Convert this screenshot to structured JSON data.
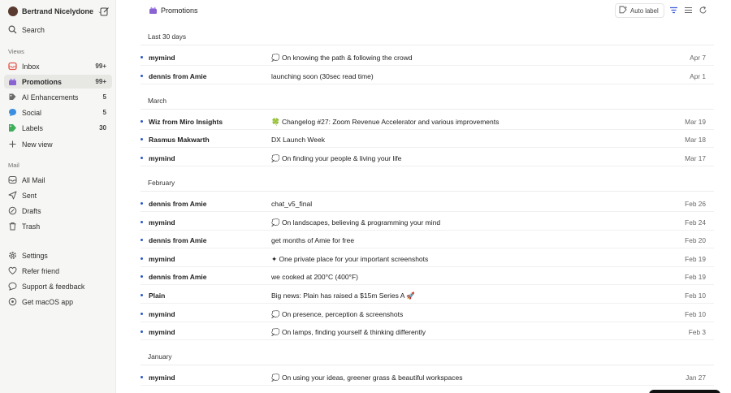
{
  "account": {
    "name": "Bertrand Nicelydone"
  },
  "search": {
    "label": "Search"
  },
  "views": {
    "heading": "Views",
    "items": [
      {
        "label": "Inbox",
        "count": "99+",
        "icon": "inbox-icon",
        "color": "#e2574c"
      },
      {
        "label": "Promotions",
        "count": "99+",
        "icon": "promotions-icon",
        "color": "#8a63d2"
      },
      {
        "label": "AI Enhancements",
        "count": "5",
        "icon": "tag-icon",
        "color": "#6b6b6b"
      },
      {
        "label": "Social",
        "count": "5",
        "icon": "social-icon",
        "color": "#3b8fe0"
      },
      {
        "label": "Labels",
        "count": "30",
        "icon": "labels-icon",
        "color": "#3fae5a"
      }
    ],
    "new_view": "New view"
  },
  "mail": {
    "heading": "Mail",
    "items": [
      {
        "label": "All Mail",
        "icon": "all-mail-icon"
      },
      {
        "label": "Sent",
        "icon": "sent-icon"
      },
      {
        "label": "Drafts",
        "icon": "drafts-icon"
      },
      {
        "label": "Trash",
        "icon": "trash-icon"
      }
    ]
  },
  "footer": {
    "settings": "Settings",
    "refer": "Refer friend",
    "support": "Support & feedback",
    "macos": "Get macOS app"
  },
  "topbar": {
    "title": "Promotions",
    "auto_label": "Auto label",
    "accent": "#3a5bd9"
  },
  "groups": [
    {
      "heading": "Last 30 days",
      "rows": [
        {
          "sender": "mymind",
          "subject": "💭 On knowing the path & following the crowd",
          "date": "Apr 7"
        },
        {
          "sender": "dennis from Amie",
          "subject": "launching soon (30sec read time)",
          "date": "Apr 1"
        }
      ]
    },
    {
      "heading": "March",
      "rows": [
        {
          "sender": "Wiz from Miro Insights",
          "subject": "🍀 Changelog #27: Zoom Revenue Accelerator and various improvements",
          "date": "Mar 19"
        },
        {
          "sender": "Rasmus Makwarth",
          "subject": "DX Launch Week",
          "date": "Mar 18"
        },
        {
          "sender": "mymind",
          "subject": "💭 On finding your people & living your life",
          "date": "Mar 17"
        }
      ]
    },
    {
      "heading": "February",
      "rows": [
        {
          "sender": "dennis from Amie",
          "subject": "chat_v5_final",
          "date": "Feb 26"
        },
        {
          "sender": "mymind",
          "subject": "💭 On landscapes, believing & programming your mind",
          "date": "Feb 24"
        },
        {
          "sender": "dennis from Amie",
          "subject": "get months of Amie for free",
          "date": "Feb 20"
        },
        {
          "sender": "mymind",
          "subject": "✦ One private place for your important screenshots",
          "date": "Feb 19"
        },
        {
          "sender": "dennis from Amie",
          "subject": "we cooked at 200°C (400°F)",
          "date": "Feb 19"
        },
        {
          "sender": "Plain",
          "subject": "Big news: Plain has raised a $15m Series A 🚀",
          "date": "Feb 10"
        },
        {
          "sender": "mymind",
          "subject": "💭 On presence, perception & screenshots",
          "date": "Feb 10"
        },
        {
          "sender": "mymind",
          "subject": "💭 On lamps, finding yourself & thinking differently",
          "date": "Feb 3"
        }
      ]
    },
    {
      "heading": "January",
      "rows": [
        {
          "sender": "mymind",
          "subject": "💭 On using your ideas, greener grass & beautiful workspaces",
          "date": "Jan 27"
        }
      ]
    }
  ]
}
